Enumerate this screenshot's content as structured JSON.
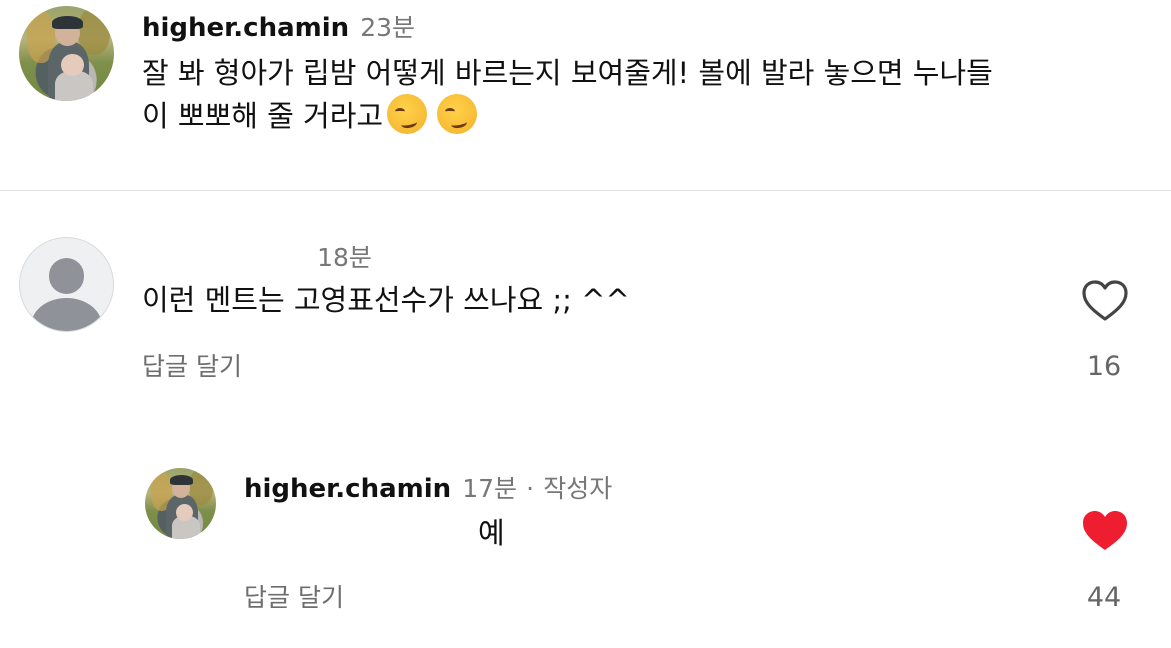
{
  "post": {
    "username": "higher.chamin",
    "time": "23분",
    "text_line1": "잘 봐 형아가 립밤 어떻게 바르는지 보여줄게! 볼에 발라 놓으면 누나들",
    "text_line2": "이 뽀뽀해 줄 거라고",
    "emoji_names": [
      "smirking-face",
      "smirking-face"
    ]
  },
  "comments": [
    {
      "username": "",
      "time": "18분",
      "text": "이런 멘트는 고영표선수가 쓰나요 ;; ^^",
      "reply_label": "답글 달기",
      "like_count": "16",
      "liked": false,
      "avatar": "default-avatar"
    },
    {
      "username": "higher.chamin",
      "time": "17분",
      "separator": "·",
      "author_badge": "작성자",
      "text": "예",
      "reply_label": "답글 달기",
      "like_count": "44",
      "liked": true,
      "avatar": "photo-avatar"
    }
  ],
  "colors": {
    "like_red": "#ee1d2f",
    "muted_text": "#777777",
    "divider": "#e4e4e4"
  },
  "icons": {
    "like_outline": "heart-outline-icon",
    "like_filled": "heart-filled-icon"
  }
}
